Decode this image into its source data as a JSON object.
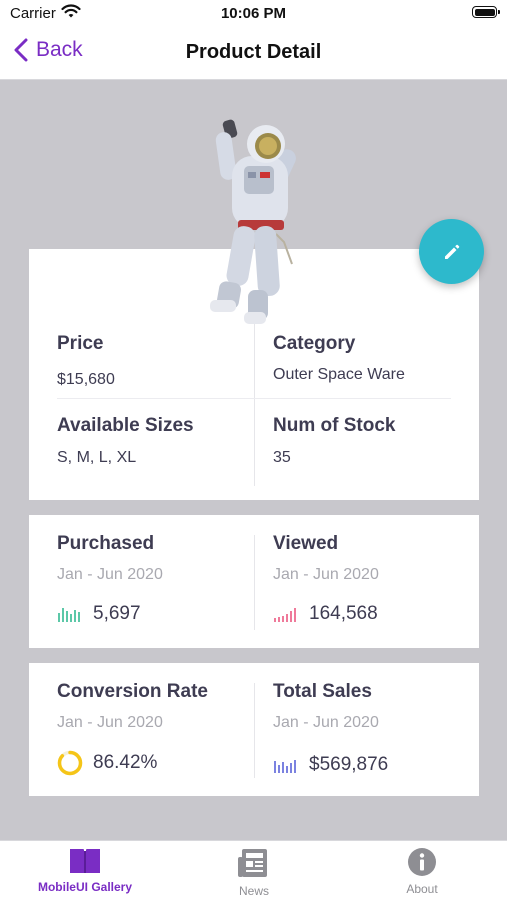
{
  "status_bar": {
    "carrier": "Carrier",
    "time": "10:06 PM"
  },
  "nav": {
    "back_label": "Back",
    "title": "Product Detail"
  },
  "product": {
    "price_label": "Price",
    "price_value": "$15,680",
    "category_label": "Category",
    "category_value": "Outer Space Ware",
    "sizes_label": "Available Sizes",
    "sizes_value": "S, M, L, XL",
    "stock_label": "Num of Stock",
    "stock_value": "35"
  },
  "stats": {
    "purchased": {
      "label": "Purchased",
      "period": "Jan - Jun 2020",
      "value": "5,697",
      "icon": "bar-chart-icon",
      "color": "#5cc8a8"
    },
    "viewed": {
      "label": "Viewed",
      "period": "Jan - Jun 2020",
      "value": "164,568",
      "icon": "bar-chart-icon",
      "color": "#ef7a9a"
    },
    "conversion": {
      "label": "Conversion Rate",
      "period": "Jan - Jun 2020",
      "value": "86.42%",
      "icon": "ring-progress-icon",
      "color": "#f5c518",
      "progress": 0.8642
    },
    "sales": {
      "label": "Total Sales",
      "period": "Jan - Jun 2020",
      "value": "$569,876",
      "icon": "bar-chart-icon",
      "color": "#7b82e0"
    }
  },
  "tabs": [
    {
      "label": "MobileUI Gallery",
      "icon": "book-icon",
      "active": true
    },
    {
      "label": "News",
      "icon": "newspaper-icon",
      "active": false
    },
    {
      "label": "About",
      "icon": "info-icon",
      "active": false
    }
  ],
  "colors": {
    "accent": "#7a2dc4",
    "fab": "#2db9cc",
    "background": "#c8c7cc"
  }
}
